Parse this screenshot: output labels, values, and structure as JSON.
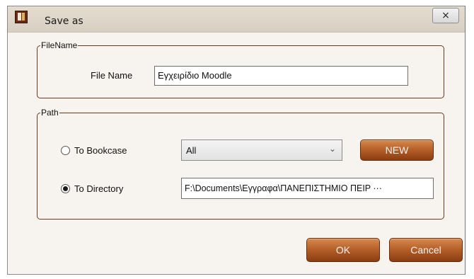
{
  "window": {
    "title": "Save as",
    "close_glyph": "×",
    "icon": "app-book-icon"
  },
  "filename_group": {
    "legend": "FileName",
    "label": "File Name",
    "value": "Εγχειρίδιο Moodle"
  },
  "path_group": {
    "legend": "Path",
    "options": [
      {
        "label": "To Bookcase",
        "selected": false
      },
      {
        "label": "To Directory",
        "selected": true
      }
    ],
    "bookcase_select": {
      "value": "All",
      "arrow": "⌄"
    },
    "new_button": "NEW",
    "directory_value": "F:\\Documents\\Εγγραφα\\ΠΑΝΕΠΙΣΤΗΜΙΟ ΠΕΙΡ ···"
  },
  "actions": {
    "ok": "OK",
    "cancel": "Cancel"
  },
  "colors": {
    "accent_button": "#b8612a",
    "frame_border": "#6a3a1e",
    "dialog_background": "#f7f3ee"
  }
}
